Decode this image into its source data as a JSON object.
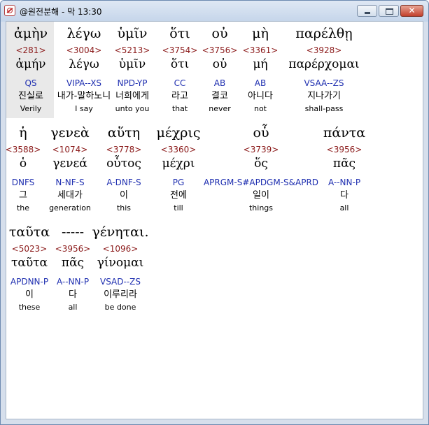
{
  "window": {
    "title": "@원전분해 - 막 13:30",
    "close_label": "✕"
  },
  "rows": [
    [
      {
        "greek": "ἀμὴν",
        "strong": "<281>",
        "lemma": "ἀμήν",
        "morph": "QS",
        "kor": "진실로",
        "eng": "Verily"
      },
      {
        "greek": "λέγω",
        "strong": "<3004>",
        "lemma": "λέγω",
        "morph": "VIPA--XS",
        "kor": "내가-말하노니",
        "eng": "I say"
      },
      {
        "greek": "ὑμῖν",
        "strong": "<5213>",
        "lemma": "ὑμῖν",
        "morph": "NPD-YP",
        "kor": "너희에게",
        "eng": "unto you"
      },
      {
        "greek": "ὅτι",
        "strong": "<3754>",
        "lemma": "ὅτι",
        "morph": "CC",
        "kor": "라고",
        "eng": "that"
      },
      {
        "greek": "οὐ",
        "strong": "<3756>",
        "lemma": "οὐ",
        "morph": "AB",
        "kor": "결코",
        "eng": "never"
      },
      {
        "greek": "μὴ",
        "strong": "<3361>",
        "lemma": "μή",
        "morph": "AB",
        "kor": "아니다",
        "eng": "not"
      },
      {
        "greek": "παρέλθῃ",
        "strong": "<3928>",
        "lemma": "παρέρχομαι",
        "morph": "VSAA--ZS",
        "kor": "지나가기",
        "eng": "shall-pass"
      }
    ],
    [
      {
        "greek": "ἡ",
        "strong": "<3588>",
        "lemma": "ὁ",
        "morph": "DNFS",
        "kor": "그",
        "eng": "the"
      },
      {
        "greek": "γενεὰ",
        "strong": "<1074>",
        "lemma": "γενεά",
        "morph": "N-NF-S",
        "kor": "세대가",
        "eng": "generation"
      },
      {
        "greek": "αὕτη",
        "strong": "<3778>",
        "lemma": "οὗτος",
        "morph": "A-DNF-S",
        "kor": "이",
        "eng": "this"
      },
      {
        "greek": "μέχρις",
        "strong": "<3360>",
        "lemma": "μέχρι",
        "morph": "PG",
        "kor": "전에",
        "eng": "till"
      },
      {
        "greek": "οὗ",
        "strong": "<3739>",
        "lemma": "ὅς",
        "morph": "APRGM-S#APDGM-S&APRD",
        "kor": "일이",
        "eng": "things"
      },
      {
        "greek": "πάντα",
        "strong": "<3956>",
        "lemma": "πᾶς",
        "morph": "A--NN-P",
        "kor": "다",
        "eng": "all"
      }
    ],
    [
      {
        "greek": "ταῦτα",
        "strong": "<5023>",
        "lemma": "ταῦτα",
        "morph": "APDNN-P",
        "kor": "이",
        "eng": "these"
      },
      {
        "greek": "-----",
        "strong": "<3956>",
        "lemma": "πᾶς",
        "morph": "A--NN-P",
        "kor": "다",
        "eng": "all"
      },
      {
        "greek": "γένηται.",
        "strong": "<1096>",
        "lemma": "γίνομαι",
        "morph": "VSAD--ZS",
        "kor": "이루리라",
        "eng": "be done"
      }
    ]
  ]
}
